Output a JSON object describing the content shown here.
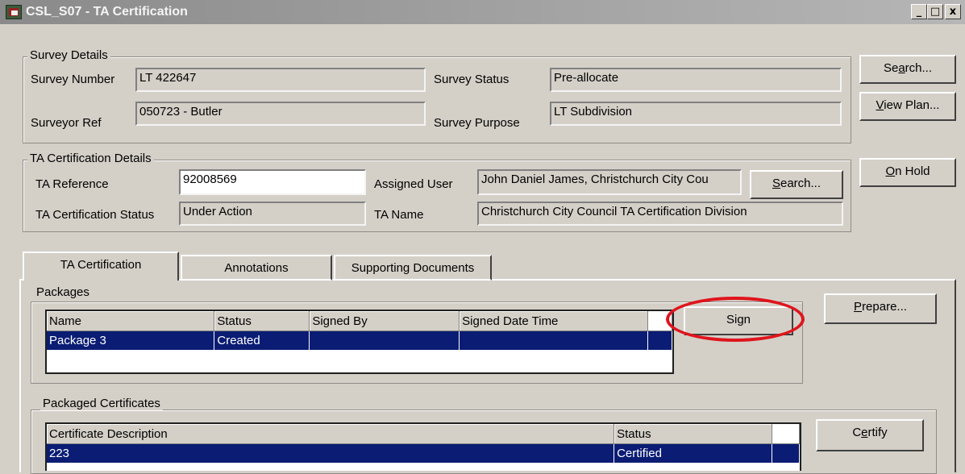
{
  "window": {
    "title": "CSL_S07 - TA Certification",
    "minimize": "_",
    "maximize": "□",
    "close": "x"
  },
  "survey_details": {
    "legend": "Survey Details",
    "survey_number_label": "Survey Number",
    "survey_number_value": "LT 422647",
    "surveyor_ref_label": "Surveyor Ref",
    "surveyor_ref_value": "050723 - Butler",
    "survey_status_label": "Survey Status",
    "survey_status_value": "Pre-allocate",
    "survey_purpose_label": "Survey Purpose",
    "survey_purpose_value": "LT Subdivision"
  },
  "side_buttons": {
    "search": {
      "pre": "Se",
      "key": "a",
      "post": "rch..."
    },
    "view_plan": {
      "pre": "",
      "key": "V",
      "post": "iew Plan..."
    },
    "on_hold": {
      "pre": "",
      "key": "O",
      "post": "n Hold"
    }
  },
  "ta_details": {
    "legend": "TA Certification Details",
    "ta_reference_label": "TA Reference",
    "ta_reference_value": "92008569",
    "status_label": "TA Certification Status",
    "status_value": "Under Action",
    "assigned_user_label": "Assigned User",
    "assigned_user_value": "John Daniel James, Christchurch City Cou",
    "ta_name_label": "TA Name",
    "ta_name_value": "Christchurch City Council TA Certification Division",
    "search_button": {
      "pre": "",
      "key": "S",
      "post": "earch..."
    }
  },
  "tabs": [
    {
      "label": "TA Certification"
    },
    {
      "label": "Annotations"
    },
    {
      "label": "Supporting Documents"
    }
  ],
  "packages": {
    "legend": "Packages",
    "columns": [
      "Name",
      "Status",
      "Signed By",
      "Signed Date Time"
    ],
    "rows": [
      {
        "name": "Package 3",
        "status": "Created",
        "signed_by": "",
        "signed_date_time": ""
      }
    ],
    "sign_button": {
      "pre": "Si",
      "key": "g",
      "post": "n"
    },
    "prepare_button": {
      "pre": "",
      "key": "P",
      "post": "repare..."
    }
  },
  "certificates": {
    "legend": "Packaged Certificates",
    "columns": [
      "Certificate Description",
      "Status"
    ],
    "rows": [
      {
        "description": "223",
        "status": "Certified"
      }
    ],
    "certify_button": {
      "pre": "C",
      "key": "e",
      "post": "rtify"
    }
  },
  "colors": {
    "selection": "#0a1c73",
    "highlight_ring": "#e0141c",
    "face": "#d4d0c8"
  }
}
